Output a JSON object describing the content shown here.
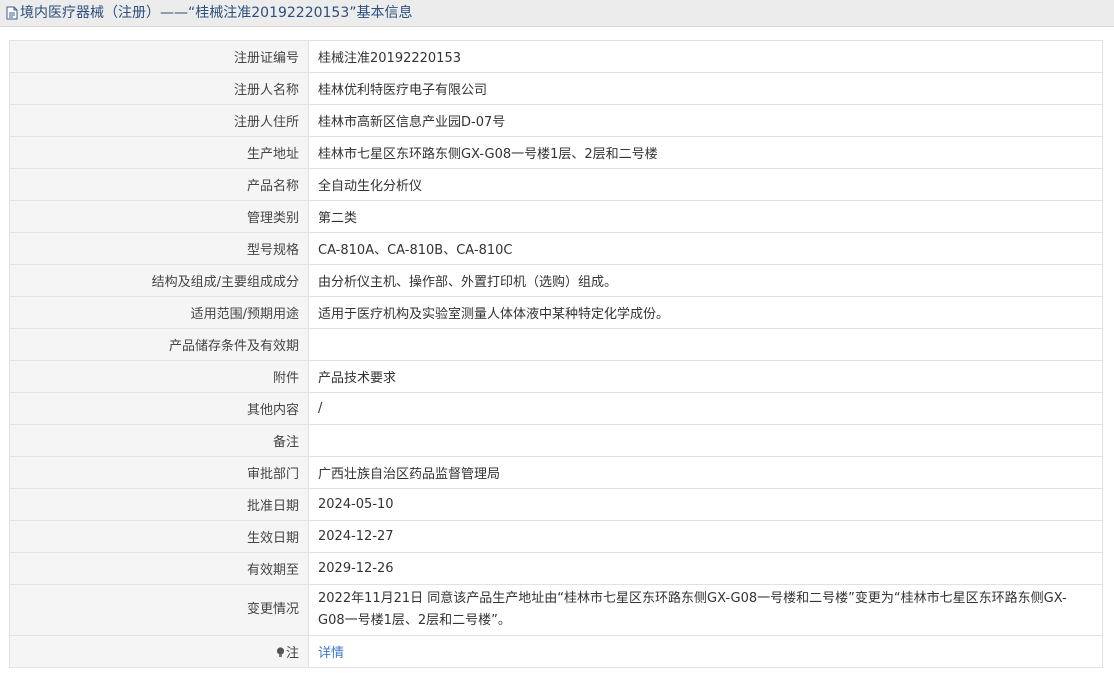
{
  "header": {
    "title": "境内医疗器械（注册）——“桂械注准20192220153”基本信息",
    "icon": "document-icon"
  },
  "rows": [
    {
      "label": "注册证编号",
      "value": "桂械注准20192220153"
    },
    {
      "label": "注册人名称",
      "value": "桂林优利特医疗电子有限公司"
    },
    {
      "label": "注册人住所",
      "value": "桂林市高新区信息产业园D-07号"
    },
    {
      "label": "生产地址",
      "value": "桂林市七星区东环路东侧GX-G08一号楼1层、2层和二号楼"
    },
    {
      "label": "产品名称",
      "value": "全自动生化分析仪"
    },
    {
      "label": "管理类别",
      "value": "第二类"
    },
    {
      "label": "型号规格",
      "value": "CA-810A、CA-810B、CA-810C"
    },
    {
      "label": "结构及组成/主要组成成分",
      "value": "由分析仪主机、操作部、外置打印机（选购）组成。"
    },
    {
      "label": "适用范围/预期用途",
      "value": "适用于医疗机构及实验室测量人体体液中某种特定化学成份。"
    },
    {
      "label": "产品储存条件及有效期",
      "value": ""
    },
    {
      "label": "附件",
      "value": "产品技术要求"
    },
    {
      "label": "其他内容",
      "value": "/"
    },
    {
      "label": "备注",
      "value": ""
    },
    {
      "label": "审批部门",
      "value": "广西壮族自治区药品监督管理局"
    },
    {
      "label": "批准日期",
      "value": "2024-05-10"
    },
    {
      "label": "生效日期",
      "value": "2024-12-27"
    },
    {
      "label": "有效期至",
      "value": "2029-12-26"
    },
    {
      "label": "变更情况",
      "value": "2022年11月21日 同意该产品生产地址由“桂林市七星区东环路东侧GX-G08一号楼和二号楼”变更为“桂林市七星区东环路东侧GX-G08一号楼1层、2层和二号楼”。"
    }
  ],
  "note": {
    "label": "注",
    "link_text": "详情",
    "icon": "lightbulb-icon"
  }
}
